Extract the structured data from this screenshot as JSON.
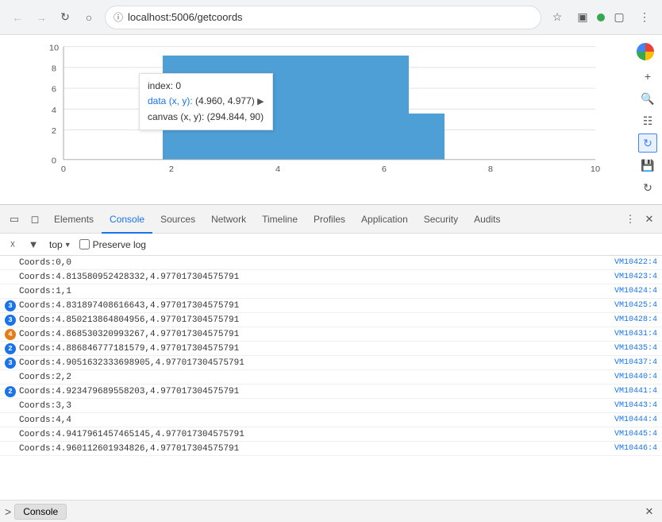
{
  "browser": {
    "url": "localhost:5006/getcoords",
    "back_btn": "←",
    "forward_btn": "→",
    "reload_btn": "↺",
    "home_btn": "⌂"
  },
  "devtools": {
    "tabs": [
      {
        "label": "Elements",
        "active": false
      },
      {
        "label": "Console",
        "active": true
      },
      {
        "label": "Sources",
        "active": false
      },
      {
        "label": "Network",
        "active": false
      },
      {
        "label": "Timeline",
        "active": false
      },
      {
        "label": "Profiles",
        "active": false
      },
      {
        "label": "Application",
        "active": false
      },
      {
        "label": "Security",
        "active": false
      },
      {
        "label": "Audits",
        "active": false
      }
    ]
  },
  "console": {
    "filter": "top",
    "preserve_log_label": "Preserve log",
    "logs": [
      {
        "text": "Coords:0,0",
        "source": "VM10422:4",
        "badge": null
      },
      {
        "text": "Coords:4.813580952428332,4.9770173045757​91",
        "source": "VM10423:4",
        "badge": null
      },
      {
        "text": "Coords:1,1",
        "source": "VM10424:4",
        "badge": null
      },
      {
        "text": "Coords:4.831897408616643,4.9770173045757​91",
        "source": "VM10425:4",
        "badge": "blue3"
      },
      {
        "text": "Coords:4.850213864804956,4.9770173045757​91",
        "source": "VM10428:4",
        "badge": "blue3"
      },
      {
        "text": "Coords:4.868530320993267,4.9770173045757​91",
        "source": "VM10431:4",
        "badge": "orange4"
      },
      {
        "text": "Coords:4.886846777181579,4.9770173045757​91",
        "source": "VM10435:4",
        "badge": "blue2"
      },
      {
        "text": "Coords:4.905163233​3698905,4.977017304575791",
        "source": "VM10437:4",
        "badge": "blue3"
      },
      {
        "text": "Coords:2,2",
        "source": "VM10440:4",
        "badge": null
      },
      {
        "text": "Coords:4.923479689558203,4.977017304575791",
        "source": "VM10441:4",
        "badge": "blue2"
      },
      {
        "text": "Coords:3,3",
        "source": "VM10443:4",
        "badge": null
      },
      {
        "text": "Coords:4,4",
        "source": "VM10444:4",
        "badge": null
      },
      {
        "text": "Coords:4.941796145746514​5,4.9770173045757​91",
        "source": "VM10445:4",
        "badge": null
      },
      {
        "text": "Coords:4.960112601934826,4.977017304575791",
        "source": "VM10446:4",
        "badge": null
      }
    ]
  },
  "bottom_bar": {
    "prompt_icon": ">",
    "tab_label": "Console",
    "close_label": "✕"
  },
  "tooltip": {
    "index": "index: 0",
    "data_xy": "data (x, y): (4.960, 4.977)",
    "canvas_xy": "canvas (x, y): (294.844, 90)"
  },
  "chart": {
    "x_labels": [
      "0",
      "2",
      "4",
      "6",
      "8",
      "10"
    ],
    "y_labels": [
      "0",
      "2",
      "4",
      "6",
      "8",
      "10"
    ],
    "bar1_height_pct": 87,
    "bar2_height_pct": 43,
    "accent_color": "#4d9fd6"
  }
}
